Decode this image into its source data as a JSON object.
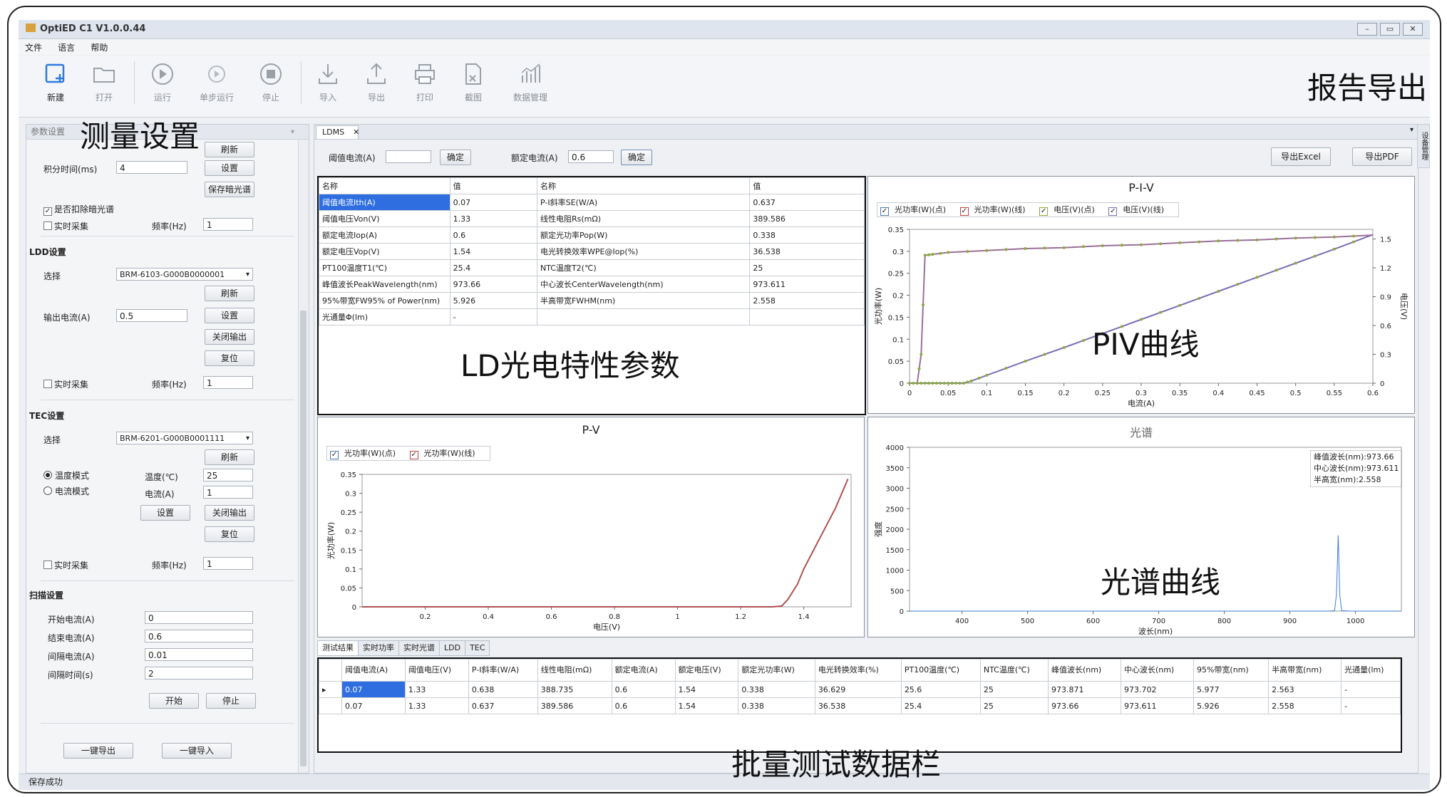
{
  "window": {
    "title": "OptiED C1 V1.0.0.44",
    "controls": [
      "–",
      "▭",
      "✕"
    ]
  },
  "menu": [
    "文件",
    "语言",
    "帮助"
  ],
  "toolbar": [
    {
      "label": "新建",
      "icon": "new-icon",
      "active": true
    },
    {
      "label": "打开",
      "icon": "open-folder-icon",
      "active": false
    },
    {
      "label": "运行",
      "icon": "run-icon",
      "active": false
    },
    {
      "label": "单步运行",
      "icon": "step-run-icon",
      "active": false
    },
    {
      "label": "停止",
      "icon": "stop-icon",
      "active": false
    },
    {
      "label": "导入",
      "icon": "import-icon",
      "active": false
    },
    {
      "label": "导出",
      "icon": "export-icon",
      "active": false
    },
    {
      "label": "打印",
      "icon": "print-icon",
      "active": false
    },
    {
      "label": "截图",
      "icon": "screenshot-icon",
      "active": false
    },
    {
      "label": "数据管理",
      "icon": "data-manage-icon",
      "active": false
    }
  ],
  "annotations": {
    "report_export": "报告导出",
    "measure_settings": "测量设置",
    "ld_params": "LD光电特性参数",
    "piv_curve": "PIV曲线",
    "spectrum_curve": "光谱曲线",
    "batch_data": "批量测试数据栏"
  },
  "left": {
    "header": "参数设置",
    "pin": "ᵠ",
    "refresh": "刷新",
    "integration_label": "积分时间(ms)",
    "integration_value": "4",
    "set": "设置",
    "save_dark": "保存暗光谱",
    "deduct_dark": "是否扣除暗光谱",
    "realtime": "实时采集",
    "freq_label": "频率(Hz)",
    "freq_value": "1",
    "ldd_title": "LDD设置",
    "select_label": "选择",
    "ldd_device": "BRM-6103-G000B0000001",
    "output_current_label": "输出电流(A)",
    "output_current_value": "0.5",
    "close_output": "关闭输出",
    "reset": "复位",
    "tec_title": "TEC设置",
    "tec_device": "BRM-6201-G000B0001111",
    "temp_mode": "温度模式",
    "current_mode": "电流模式",
    "temp_label": "温度(℃)",
    "temp_value": "25",
    "current_label": "电流(A)",
    "current_value": "1",
    "scan_title": "扫描设置",
    "start_current_label": "开始电流(A)",
    "start_current_value": "0",
    "end_current_label": "结束电流(A)",
    "end_current_value": "0.6",
    "interval_current_label": "间隔电流(A)",
    "interval_current_value": "0.01",
    "interval_time_label": "间隔时间(s)",
    "interval_time_value": "2",
    "start": "开始",
    "stop": "停止",
    "export_all": "一键导出",
    "import_all": "一键导入"
  },
  "main": {
    "tab": "LDMS",
    "tab_close": "✕",
    "threshold_label": "阈值电流(A)",
    "threshold_value": "",
    "ok": "确定",
    "rated_label": "额定电流(A)",
    "rated_value": "0.6",
    "export_excel": "导出Excel",
    "export_pdf": "导出PDF",
    "param_headers": [
      "名称",
      "值",
      "名称",
      "值"
    ],
    "param_rows": [
      [
        "阈值电流Ith(A)",
        "0.07",
        "P-I斜率SE(W/A)",
        "0.637"
      ],
      [
        "阈值电压Von(V)",
        "1.33",
        "线性电阻Rs(mΩ)",
        "389.586"
      ],
      [
        "额定电流Iop(A)",
        "0.6",
        "额定光功率Pop(W)",
        "0.338"
      ],
      [
        "额定电压Vop(V)",
        "1.54",
        "电光转换效率WPE@Iop(%)",
        "36.538"
      ],
      [
        "PT100温度T1(℃)",
        "25.4",
        "NTC温度T2(℃)",
        "25"
      ],
      [
        "峰值波长PeakWavelength(nm)",
        "973.66",
        "中心波长CenterWavelength(nm)",
        "973.611"
      ],
      [
        "95%带宽FW95% of Power(nm)",
        "5.926",
        "半高带宽FWHM(nm)",
        "2.558"
      ],
      [
        "光通量Φ(lm)",
        "-",
        "",
        ""
      ]
    ],
    "bottom_tabs": [
      "测试结果",
      "实时功率",
      "实时光谱",
      "LDD",
      "TEC"
    ],
    "batch_headers": [
      "阈值电流(A)",
      "阈值电压(V)",
      "P-I斜率(W/A)",
      "线性电阻(mΩ)",
      "额定电流(A)",
      "额定电压(V)",
      "额定光功率(W)",
      "电光转换效率(%)",
      "PT100温度(℃)",
      "NTC温度(℃)",
      "峰值波长(nm)",
      "中心波长(nm)",
      "95%带宽(nm)",
      "半高带宽(nm)",
      "光通量(lm)"
    ],
    "batch_rows": [
      [
        "0.07",
        "1.33",
        "0.638",
        "388.735",
        "0.6",
        "1.54",
        "0.338",
        "36.629",
        "25.6",
        "25",
        "973.871",
        "973.702",
        "5.977",
        "2.563",
        "-"
      ],
      [
        "0.07",
        "1.33",
        "0.637",
        "389.586",
        "0.6",
        "1.54",
        "0.338",
        "36.538",
        "25.4",
        "25",
        "973.66",
        "973.611",
        "5.926",
        "2.558",
        "-"
      ]
    ],
    "side_tab": "设备管理"
  },
  "status": "保存成功",
  "chart_data": [
    {
      "type": "line",
      "title": "P-I-V",
      "xlabel": "电流(A)",
      "ylabel": "光功率(W)",
      "y2label": "电压(V)",
      "legend": [
        "光功率(W)(点)",
        "光功率(W)(线)",
        "电压(V)(点)",
        "电压(V)(线)"
      ],
      "xlim": [
        0,
        0.6
      ],
      "ylim": [
        0,
        0.35
      ],
      "y2lim": [
        0,
        1.6
      ],
      "xticks": [
        "0",
        "0.05",
        "0.1",
        "0.15",
        "0.2",
        "0.25",
        "0.3",
        "0.35",
        "0.4",
        "0.45",
        "0.5",
        "0.55",
        "0.6"
      ],
      "yticks": [
        "0",
        "0.05",
        "0.1",
        "0.15",
        "0.2",
        "0.25",
        "0.3",
        "0.35"
      ],
      "y2ticks": [
        "0",
        "0.3",
        "0.6",
        "0.9",
        "1.2",
        "1.5"
      ],
      "series": [
        {
          "name": "光功率(W)",
          "color": "#7b6fb8",
          "x": [
            0,
            0.01,
            0.02,
            0.03,
            0.04,
            0.05,
            0.06,
            0.07,
            0.08,
            0.1,
            0.15,
            0.2,
            0.25,
            0.3,
            0.35,
            0.4,
            0.45,
            0.5,
            0.55,
            0.6
          ],
          "y": [
            0,
            0,
            0,
            0,
            0,
            0,
            0,
            0,
            0.005,
            0.018,
            0.05,
            0.081,
            0.113,
            0.145,
            0.177,
            0.209,
            0.241,
            0.273,
            0.305,
            0.338
          ]
        },
        {
          "name": "电压(V)",
          "color": "#9a6f9a",
          "x": [
            0.01,
            0.015,
            0.02,
            0.03,
            0.05,
            0.1,
            0.15,
            0.2,
            0.25,
            0.3,
            0.35,
            0.4,
            0.45,
            0.5,
            0.55,
            0.6
          ],
          "y": [
            0,
            0.3,
            1.33,
            1.34,
            1.36,
            1.38,
            1.4,
            1.41,
            1.43,
            1.44,
            1.46,
            1.48,
            1.49,
            1.51,
            1.52,
            1.54
          ]
        }
      ]
    },
    {
      "type": "line",
      "title": "P-V",
      "xlabel": "电压(V)",
      "ylabel": "光功率(W)",
      "legend": [
        "光功率(W)(点)",
        "光功率(W)(线)"
      ],
      "xlim": [
        0,
        1.55
      ],
      "ylim": [
        0,
        0.35
      ],
      "xticks": [
        "0.2",
        "0.4",
        "0.6",
        "0.8",
        "1",
        "1.2",
        "1.4"
      ],
      "yticks": [
        "0",
        "0.05",
        "0.1",
        "0.15",
        "0.2",
        "0.25",
        "0.3",
        "0.35"
      ],
      "series": [
        {
          "name": "光功率(W)",
          "color": "#b05050",
          "x": [
            0,
            0.3,
            1.0,
            1.3,
            1.33,
            1.35,
            1.38,
            1.4,
            1.45,
            1.5,
            1.54
          ],
          "y": [
            0,
            0,
            0,
            0,
            0.002,
            0.02,
            0.06,
            0.1,
            0.18,
            0.26,
            0.338
          ]
        }
      ]
    },
    {
      "type": "line",
      "title": "光谱",
      "xlabel": "波长(nm)",
      "ylabel": "强度",
      "annotation": [
        "峰值波长(nm):973.66",
        "中心波长(nm):973.611",
        "半高宽(nm):2.558"
      ],
      "xlim": [
        320,
        1070
      ],
      "ylim": [
        0,
        4000
      ],
      "xticks": [
        "400",
        "500",
        "600",
        "700",
        "800",
        "900",
        "1000"
      ],
      "yticks": [
        "0",
        "500",
        "1000",
        "1500",
        "2000",
        "2500",
        "3000",
        "3500",
        "4000"
      ],
      "series": [
        {
          "name": "强度",
          "color": "#3a7bd5",
          "x": [
            320,
            960,
            968,
            971,
            973.66,
            976,
            979,
            990,
            1070
          ],
          "y": [
            0,
            0,
            10,
            400,
            1850,
            400,
            10,
            0,
            0
          ]
        }
      ]
    }
  ]
}
